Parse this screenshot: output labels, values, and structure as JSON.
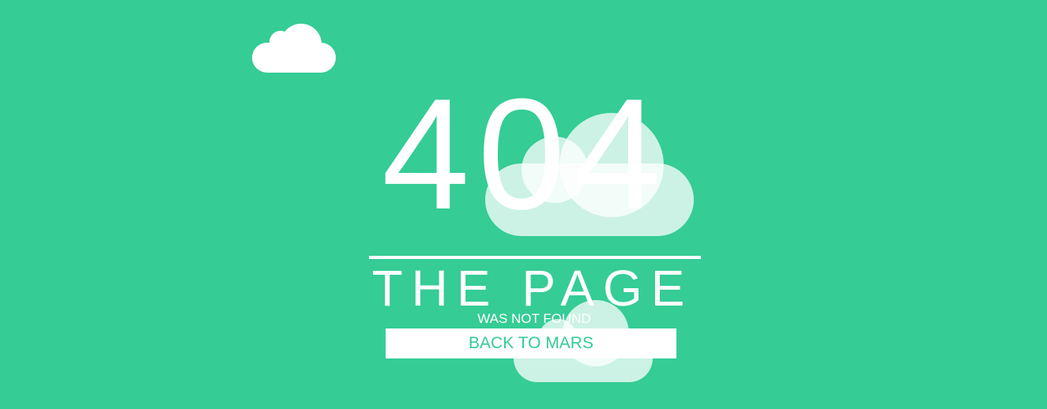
{
  "error": {
    "code": "404",
    "headline": "THE PAGE",
    "subline": "WAS NOT FOUND"
  },
  "actions": {
    "back_label": "BACK TO MARS"
  },
  "decor": {
    "clouds": [
      "cloud-icon",
      "cloud-icon",
      "cloud-icon"
    ]
  },
  "colors": {
    "background": "#35cc96",
    "foreground": "#ffffff",
    "cloud_translucent": "rgba(255,255,255,0.75)"
  }
}
